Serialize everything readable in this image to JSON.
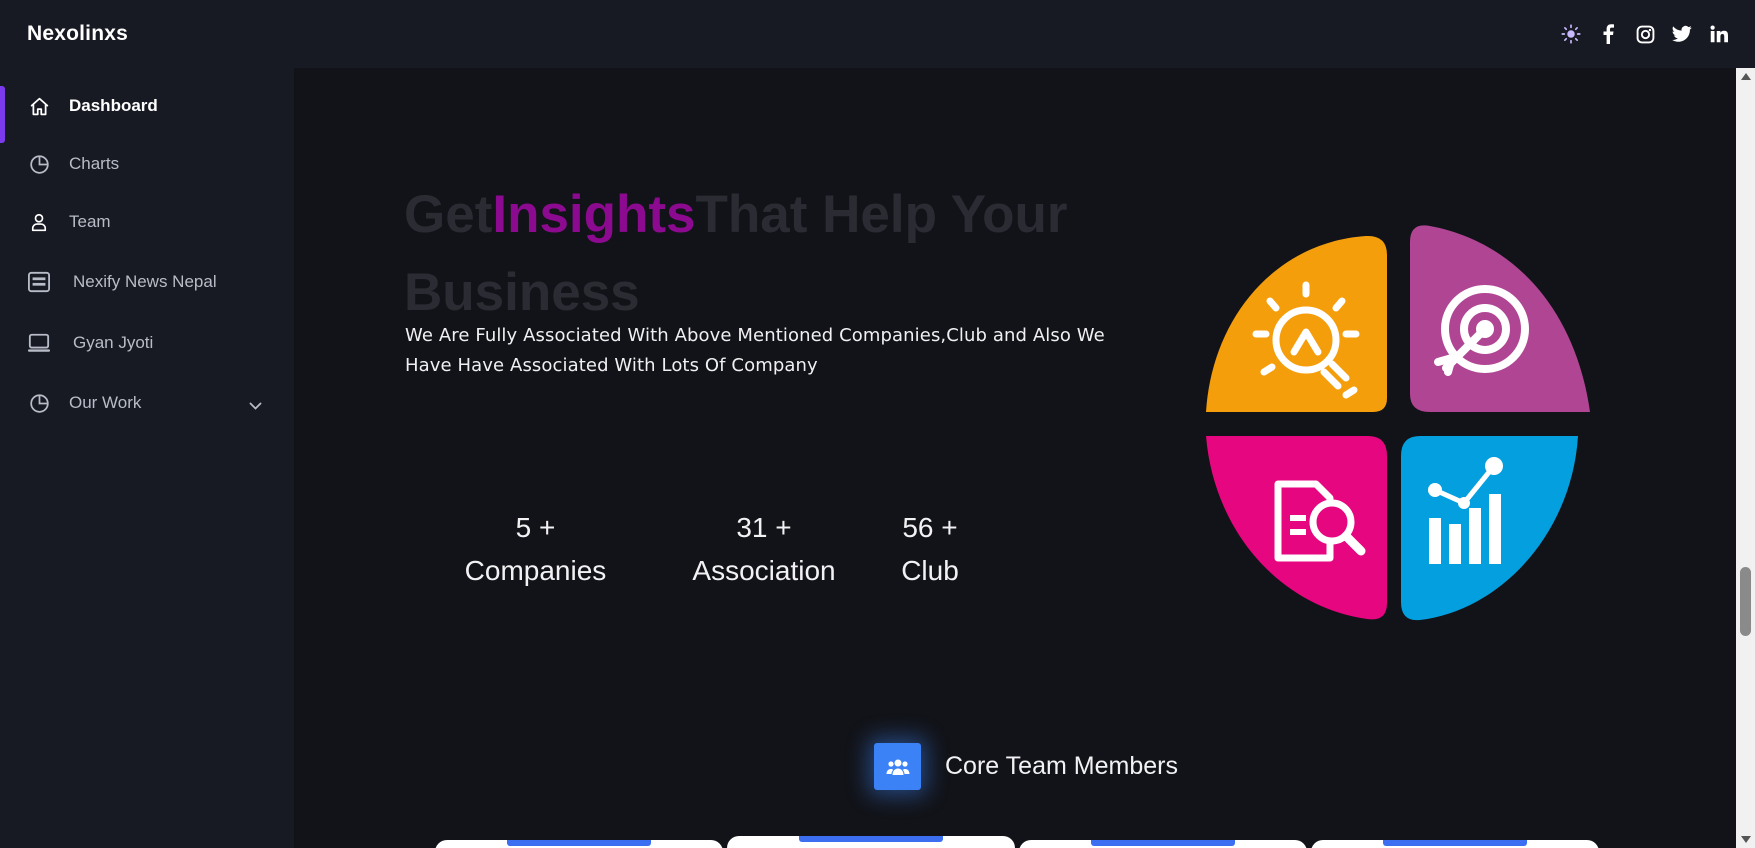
{
  "app": {
    "brand": "Nexolinxs"
  },
  "top_icons": [
    "sun-icon",
    "facebook-icon",
    "instagram-icon",
    "twitter-icon",
    "linkedin-icon"
  ],
  "sidebar": {
    "items": [
      {
        "label": "Dashboard",
        "icon": "home-icon",
        "active": true
      },
      {
        "label": "Charts",
        "icon": "pie-chart-icon"
      },
      {
        "label": "Team",
        "icon": "user-icon"
      },
      {
        "label": "Nexify News Nepal",
        "icon": "newspaper-icon"
      },
      {
        "label": "Gyan Jyoti",
        "icon": "laptop-icon"
      },
      {
        "label": "Our Work",
        "icon": "pie-chart-icon",
        "has_dropdown": true
      }
    ]
  },
  "hero": {
    "title_pre": "Get",
    "title_highlight": "Insights",
    "title_post": "That Help Your Business",
    "subtitle": "We Are Fully Associated With Above Mentioned Companies,Club and Also We Have Have Associated With Lots Of Company",
    "stats": [
      {
        "value": "5 +",
        "label": "Companies"
      },
      {
        "value": "31 +",
        "label": "Association"
      },
      {
        "value": "56 +",
        "label": "Club"
      }
    ]
  },
  "illustration": {
    "quadrants": [
      {
        "icon": "lightbulb-icon",
        "color": "#f59e0b"
      },
      {
        "icon": "target-icon",
        "color": "#b04593"
      },
      {
        "icon": "document-search-icon",
        "color": "#e6067f"
      },
      {
        "icon": "bar-chart-icon",
        "color": "#049fdf"
      }
    ]
  },
  "team": {
    "title": "Core Team Members",
    "icon": "users-icon"
  },
  "colors": {
    "accent": "#7c3aed",
    "highlight": "#8b0a8f",
    "team_icon_bg": "#3b82f6"
  }
}
